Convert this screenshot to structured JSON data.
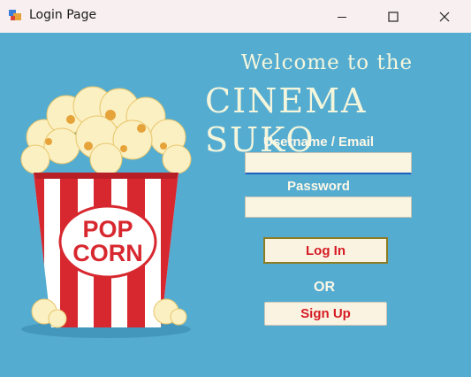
{
  "window": {
    "title": "Login Page",
    "app_icon": "winforms-app-icon",
    "controls": {
      "minimize": "minimize-icon",
      "maximize": "maximize-icon",
      "close": "close-icon"
    }
  },
  "branding": {
    "welcome": "Welcome to the",
    "cinema_name": "CINEMA SUKO",
    "popcorn_label_line1": "POP",
    "popcorn_label_line2": "CORN"
  },
  "form": {
    "username_label": "Username / Email",
    "username_value": "",
    "password_label": "Password",
    "password_value": "",
    "login_button": "Log In",
    "or_text": "OR",
    "signup_button": "Sign Up"
  },
  "colors": {
    "background": "#55acd1",
    "title_bar": "#f8eff0",
    "button_text": "#d61b24",
    "input_bg": "#faf5e1",
    "headline": "#f4f6dc"
  }
}
